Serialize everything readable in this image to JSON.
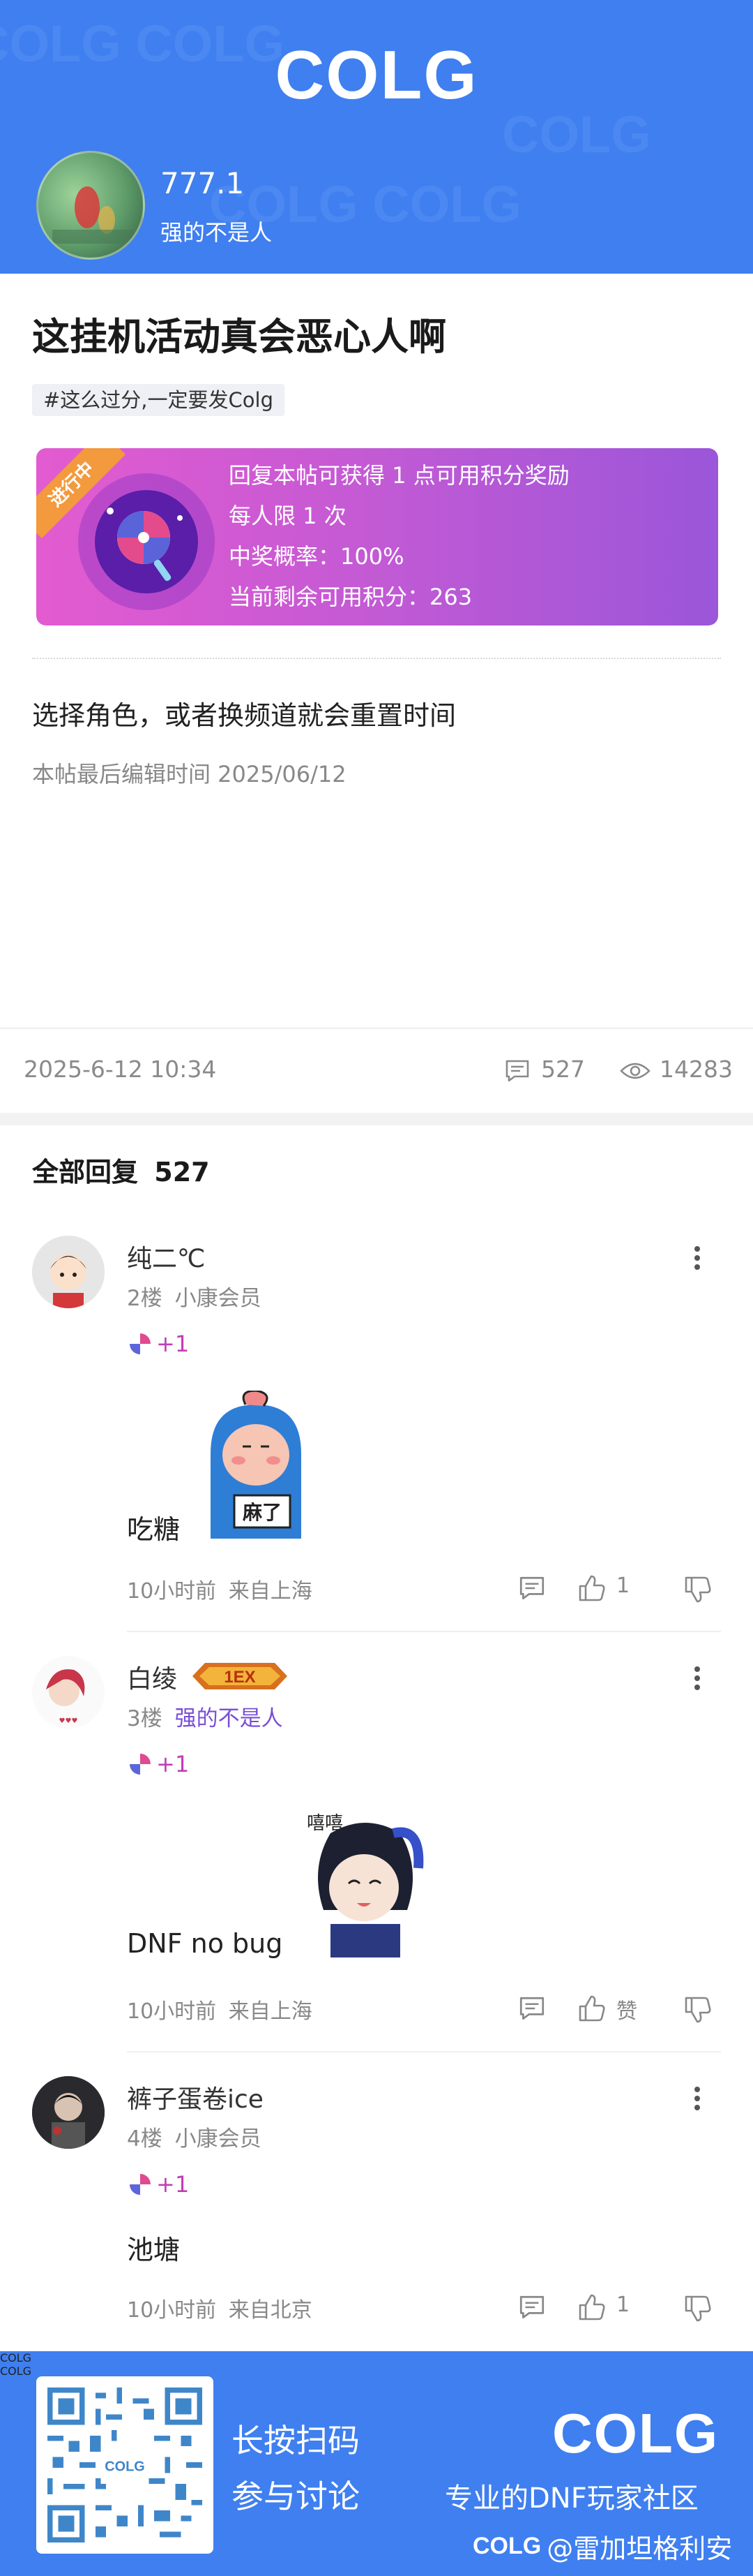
{
  "header": {
    "logo": "COLG",
    "user_name": "777.1",
    "user_title": "强的不是人",
    "bg_color": "#3f7ff0"
  },
  "post": {
    "title": "这挂机活动真会恶心人啊",
    "tag": "#这么过分,一定要发Colg",
    "reward": {
      "ribbon": "进行中",
      "line1": "回复本帖可获得 1 点可用积分奖励",
      "line2": "每人限 1 次",
      "line3": "中奖概率：100%",
      "line4": "当前剩余可用积分：263"
    },
    "content": "选择角色，或者换频道就会重置时间",
    "edited": "本帖最后编辑时间 2025/06/12",
    "date": "2025-6-12 10:34",
    "comment_count": "527",
    "view_count": "14283"
  },
  "replies": {
    "header": "全部回复",
    "count": "527",
    "items": [
      {
        "name": "纯二℃",
        "floor": "2楼",
        "member": "小康会员",
        "plus": "+1",
        "sticker_text": "麻了",
        "text": "吃糖",
        "time": "10小时前",
        "loc": "来自上海",
        "likes": "1"
      },
      {
        "name": "白绫",
        "badge": "1EX",
        "floor": "3楼",
        "member": "强的不是人",
        "plus": "+1",
        "sticker_text": "嘻嘻",
        "text": "DNF no bug",
        "time": "10小时前",
        "loc": "来自上海",
        "likes": "赞"
      },
      {
        "name": "裤子蛋卷ice",
        "floor": "4楼",
        "member": "小康会员",
        "plus": "+1",
        "text": "池塘",
        "time": "10小时前",
        "loc": "来自北京",
        "likes": "1"
      }
    ]
  },
  "footer": {
    "scan": "长按扫码",
    "join": "参与讨论",
    "logo": "COLG",
    "slogan": "专业的DNF玩家社区",
    "signature_logo": "COLG",
    "signature": "@雷加坦格利安"
  },
  "icons": [
    "comment-icon",
    "eye-icon",
    "thumb-up-icon",
    "thumb-down-icon",
    "more-icon",
    "candy-icon",
    "lollipop-icon"
  ]
}
